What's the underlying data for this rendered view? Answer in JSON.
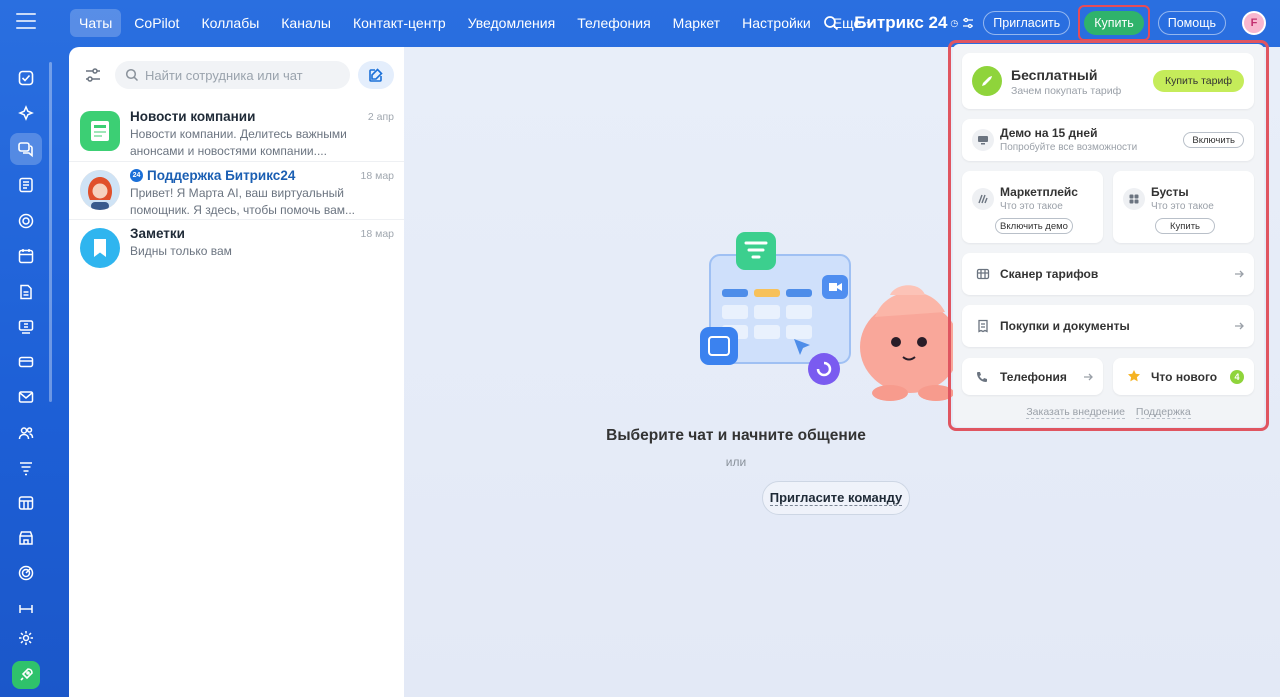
{
  "nav": {
    "items": [
      {
        "label": "Чаты",
        "active": true
      },
      {
        "label": "CoPilot",
        "active": false
      },
      {
        "label": "Коллабы",
        "active": false
      },
      {
        "label": "Каналы",
        "active": false
      },
      {
        "label": "Контакт-центр",
        "active": false
      },
      {
        "label": "Уведомления",
        "active": false
      },
      {
        "label": "Телефония",
        "active": false
      },
      {
        "label": "Маркет",
        "active": false
      },
      {
        "label": "Настройки",
        "active": false
      }
    ],
    "more_label": "Еще"
  },
  "header": {
    "brand": "Битрикс 24",
    "invite_label": "Пригласить",
    "buy_label": "Купить",
    "help_label": "Помощь",
    "avatar_initial": "F"
  },
  "chatlist": {
    "search_placeholder": "Найти сотрудника или чат",
    "chats": [
      {
        "title": "Новости компании",
        "date": "2 апр",
        "preview": "Новости компании. Делитесь важными анонсами и новостями компании...."
      },
      {
        "title": "Поддержка Битрикс24",
        "date": "18 мар",
        "preview": "Привет! Я Марта AI, ваш виртуальный помощник. Я здесь, чтобы помочь вам..."
      },
      {
        "title": "Заметки",
        "date": "18 мар",
        "preview": "Видны только вам"
      }
    ]
  },
  "main": {
    "title": "Выберите чат и начните общение",
    "or_label": "или",
    "invite_team_label": "Пригласите команду"
  },
  "popup": {
    "plan_title": "Бесплатный",
    "plan_sub": "Зачем покупать тариф",
    "plan_button": "Купить тариф",
    "demo_title": "Демо на 15 дней",
    "demo_sub": "Попробуйте все возможности",
    "demo_button": "Включить",
    "market_title": "Маркетплейс",
    "market_sub": "Что это такое",
    "market_button": "Включить демо",
    "boosts_title": "Бусты",
    "boosts_sub": "Что это такое",
    "boosts_button": "Купить",
    "scanner_label": "Сканер тарифов",
    "purchases_label": "Покупки и документы",
    "telephony_label": "Телефония",
    "whats_new_label": "Что нового",
    "whats_new_count": "4",
    "footer_order": "Заказать внедрение",
    "footer_support": "Поддержка"
  },
  "colors": {
    "accent": "#2a6fe0",
    "buy_green": "#2fb36b",
    "highlight_red": "#e05560",
    "lime": "#c5ec5a"
  }
}
